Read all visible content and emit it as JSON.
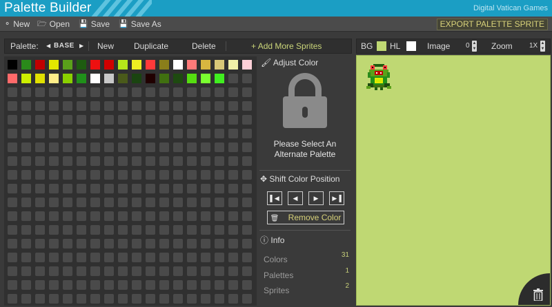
{
  "app": {
    "title": "Palette Builder",
    "brand": "Digital Vatican Games"
  },
  "toolbar": {
    "new_label": "New",
    "open_label": "Open",
    "save_label": "Save",
    "save_as_label": "Save As",
    "export_label": "EXPORT PALETTE SPRITE"
  },
  "palette_bar": {
    "palette_label": "Palette:",
    "current_palette": "BASE",
    "new_label": "New",
    "duplicate_label": "Duplicate",
    "delete_label": "Delete",
    "add_sprites_label": "Add More Sprites"
  },
  "swatches": {
    "row1": [
      "#000000",
      "#2a8a1a",
      "#c00000",
      "#e4e800",
      "#5aa01a",
      "#1e5c10",
      "#ee1010",
      "#d00000",
      "#b6e61a",
      "#eeee22",
      "#ff3a3a",
      "#8a7e1a",
      "#ffffff",
      "#ff7a7a",
      "#d8b640",
      "#d8c878",
      "#f0f0a8",
      "#ffd0d8"
    ],
    "row2": [
      "#ff6a6a",
      "#ccee00",
      "#e0e000",
      "#ffee88",
      "#8ad000",
      "#20901a",
      "#ffffff",
      "#c8c8c8",
      "#4a5a1a",
      "#1a4410",
      "#200000",
      "#407010",
      "#1e4a10",
      "#55dd10",
      "#7aff30",
      "#40ee20"
    ]
  },
  "adjust": {
    "title": "Adjust Color",
    "lock_message_line1": "Please Select An",
    "lock_message_line2": "Alternate Palette"
  },
  "shift": {
    "title": "Shift Color Position",
    "remove_label": "Remove Color"
  },
  "info": {
    "title": "Info",
    "rows": [
      {
        "label": "Colors",
        "value": "31"
      },
      {
        "label": "Palettes",
        "value": "1"
      },
      {
        "label": "Sprites",
        "value": "2"
      }
    ]
  },
  "preview": {
    "bg_label": "BG",
    "bg_color": "#bfd873",
    "hl_label": "HL",
    "hl_color": "#ffffff",
    "image_label": "Image",
    "image_value": "0",
    "zoom_label": "Zoom",
    "zoom_value": "1X"
  }
}
